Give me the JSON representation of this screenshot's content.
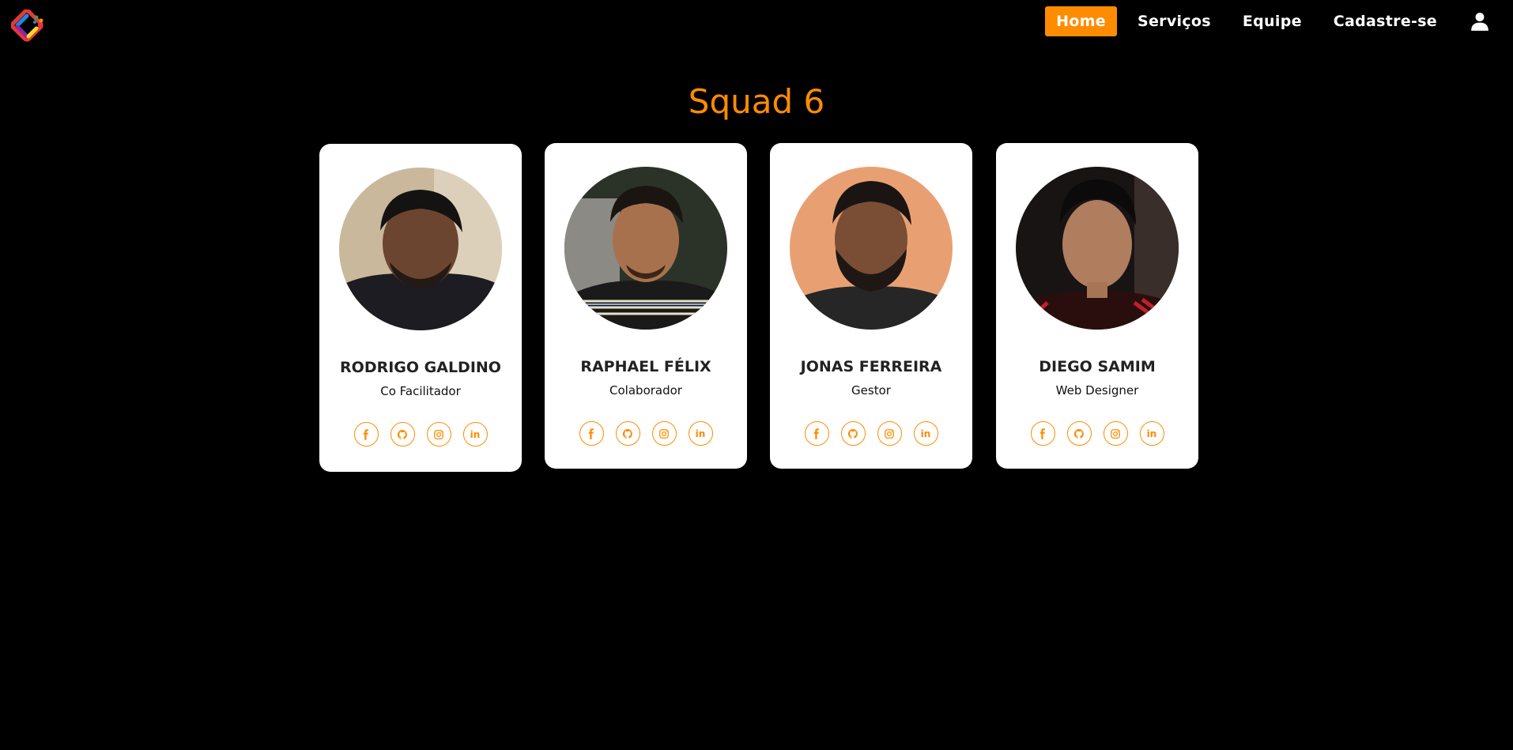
{
  "nav": {
    "logo_icon": "colorful-diamond-logo-icon",
    "links": [
      {
        "label": "Home",
        "active": true
      },
      {
        "label": "Serviços",
        "active": false
      },
      {
        "label": "Equipe",
        "active": false
      },
      {
        "label": "Cadastre-se",
        "active": false
      }
    ],
    "user_icon": "user-icon"
  },
  "page_title": "Squad 6",
  "colors": {
    "accent": "#ff8c00",
    "background": "#000000",
    "card": "#ffffff"
  },
  "members": [
    {
      "name": "RODRIGO GALDINO",
      "role": "Co Facilitador"
    },
    {
      "name": "RAPHAEL FÉLIX",
      "role": "Colaborador"
    },
    {
      "name": "JONAS FERREIRA",
      "role": "Gestor"
    },
    {
      "name": "DIEGO SAMIM",
      "role": "Web Designer"
    }
  ],
  "social_icons": [
    "facebook-icon",
    "github-icon",
    "instagram-icon",
    "linkedin-icon"
  ]
}
